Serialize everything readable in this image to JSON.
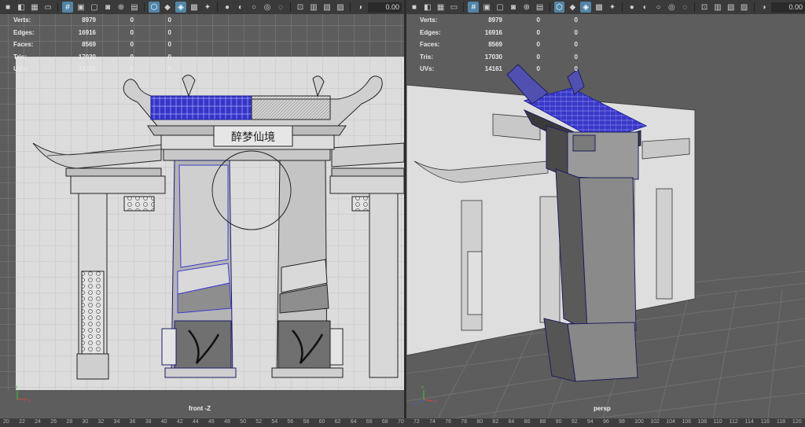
{
  "toolbar_icons": [
    "camera-icon",
    "camera-attrs-icon",
    "bookmark-icon",
    "image-plane-icon",
    "grid-icon",
    "film-gate-icon",
    "resolution-gate-icon",
    "gate-mask-icon",
    "field-chart-icon",
    "safe-action-icon",
    "safe-title-icon",
    "wireframe-icon",
    "smooth-shade-icon",
    "wireframe-on-shaded-icon",
    "textured-icon",
    "use-all-lights-icon",
    "shadows-icon",
    "ambient-occlusion-icon",
    "motion-blur-icon",
    "anti-alias-icon",
    "depth-of-field-icon",
    "isolate-select-icon",
    "xray-icon",
    "xray-joints-icon",
    "xray-components-icon",
    "exposure-icon"
  ],
  "front": {
    "exposure_value": "0.00",
    "hud": [
      {
        "label": "Verts:",
        "v1": "8979",
        "v2": "0",
        "v3": "0"
      },
      {
        "label": "Edges:",
        "v1": "16916",
        "v2": "0",
        "v3": "0"
      },
      {
        "label": "Faces:",
        "v1": "8569",
        "v2": "0",
        "v3": "0"
      },
      {
        "label": "Tris:",
        "v1": "17030",
        "v2": "0",
        "v3": "0"
      },
      {
        "label": "UVs:",
        "v1": "14161",
        "v2": "0",
        "v3": "0"
      }
    ],
    "camera_label": "front -Z",
    "plaque_text": "醉梦仙境"
  },
  "persp": {
    "exposure_value": "0.00",
    "hud": [
      {
        "label": "Verts:",
        "v1": "8979",
        "v2": "0",
        "v3": "0"
      },
      {
        "label": "Edges:",
        "v1": "16916",
        "v2": "0",
        "v3": "0"
      },
      {
        "label": "Faces:",
        "v1": "8569",
        "v2": "0",
        "v3": "0"
      },
      {
        "label": "Tris:",
        "v1": "17030",
        "v2": "0",
        "v3": "0"
      },
      {
        "label": "UVs:",
        "v1": "14161",
        "v2": "0",
        "v3": "0"
      }
    ],
    "camera_label": "persp"
  },
  "axis_labels": {
    "x": "x",
    "y": "y",
    "z": "z"
  },
  "timeline": {
    "ticks": [
      "20",
      "22",
      "24",
      "26",
      "28",
      "30",
      "32",
      "34",
      "36",
      "38",
      "40",
      "42",
      "44",
      "46",
      "48",
      "50",
      "52",
      "54",
      "56",
      "58",
      "60",
      "62",
      "64",
      "66",
      "68",
      "70",
      "72",
      "74",
      "76",
      "78",
      "80",
      "82",
      "84",
      "86",
      "88",
      "90",
      "92",
      "94",
      "96",
      "98",
      "100",
      "102",
      "104",
      "106",
      "108",
      "110",
      "112",
      "114",
      "116",
      "118",
      "120"
    ]
  },
  "colors": {
    "selection": "#3c3cd2",
    "selection_wire": "#a0a0ff",
    "viewport_bg": "#5d5d5d",
    "active_icon": "#5285a6"
  }
}
